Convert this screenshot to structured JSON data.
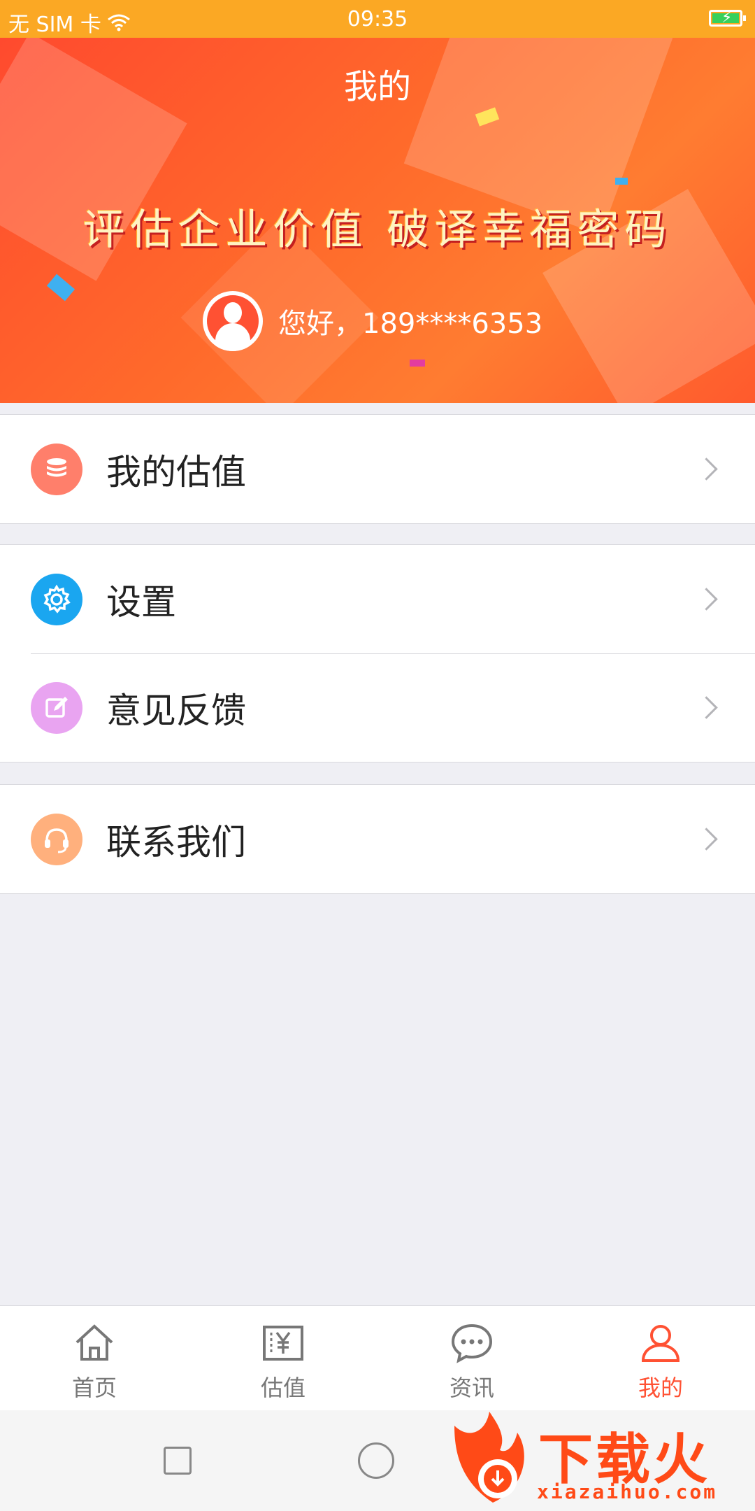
{
  "status_bar": {
    "carrier": "无 SIM 卡",
    "time": "09:35"
  },
  "header": {
    "title": "我的",
    "slogan": "评估企业价值  破译幸福密码",
    "greeting": "您好，189****6353"
  },
  "menu_groups": [
    {
      "items": [
        {
          "label": "我的估值",
          "icon": "coins-stack-icon",
          "color": "#ff7f6b"
        }
      ]
    },
    {
      "items": [
        {
          "label": "设置",
          "icon": "gear-icon",
          "color": "#1aa6f0"
        },
        {
          "label": "意见反馈",
          "icon": "edit-icon",
          "color": "#e9a4f1"
        }
      ]
    },
    {
      "items": [
        {
          "label": "联系我们",
          "icon": "headset-icon",
          "color": "#ffb07d"
        }
      ]
    }
  ],
  "tabbar": {
    "tabs": [
      {
        "label": "首页",
        "icon": "home-icon"
      },
      {
        "label": "估值",
        "icon": "yen-icon"
      },
      {
        "label": "资讯",
        "icon": "chat-bubble-icon"
      },
      {
        "label": "我的",
        "icon": "user-icon",
        "active": true
      }
    ],
    "active_color": "#ff5133"
  },
  "watermark": {
    "text": "下载火",
    "url": "xiazaihuo.com"
  }
}
